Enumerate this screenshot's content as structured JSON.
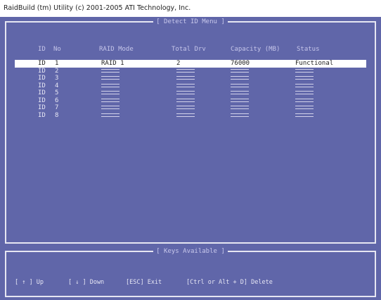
{
  "window": {
    "title": "RaidBuild (tm) Utility (c) 2001-2005 ATI Technology, Inc."
  },
  "menu": {
    "title": "[ Detect ID Menu ]",
    "headers": {
      "id": "ID",
      "no": "No",
      "raid_mode": "RAID Mode",
      "total_drv": "Total Drv",
      "capacity": "Capacity (MB)",
      "status": "Status"
    },
    "rows": [
      {
        "id": "ID",
        "no": "1",
        "raid": "RAID 1",
        "drv": "2",
        "cap": "76000",
        "status": "Functional",
        "selected": true
      },
      {
        "id": "ID",
        "no": "2",
        "raid": "",
        "drv": "",
        "cap": "",
        "status": "",
        "selected": false
      },
      {
        "id": "ID",
        "no": "3",
        "raid": "",
        "drv": "",
        "cap": "",
        "status": "",
        "selected": false
      },
      {
        "id": "ID",
        "no": "4",
        "raid": "",
        "drv": "",
        "cap": "",
        "status": "",
        "selected": false
      },
      {
        "id": "ID",
        "no": "5",
        "raid": "",
        "drv": "",
        "cap": "",
        "status": "",
        "selected": false
      },
      {
        "id": "ID",
        "no": "6",
        "raid": "",
        "drv": "",
        "cap": "",
        "status": "",
        "selected": false
      },
      {
        "id": "ID",
        "no": "7",
        "raid": "",
        "drv": "",
        "cap": "",
        "status": "",
        "selected": false
      },
      {
        "id": "ID",
        "no": "8",
        "raid": "",
        "drv": "",
        "cap": "",
        "status": "",
        "selected": false
      }
    ]
  },
  "keys": {
    "title": "[ Keys Available ]",
    "items": [
      "[ ↑ ] Up",
      "[ ↓ ] Down",
      "[ESC] Exit",
      "[Ctrl or Alt + D] Delete"
    ]
  },
  "colors": {
    "background": "#6066a9",
    "frame": "#e6e6f2",
    "selected_row": "#ffffff"
  }
}
